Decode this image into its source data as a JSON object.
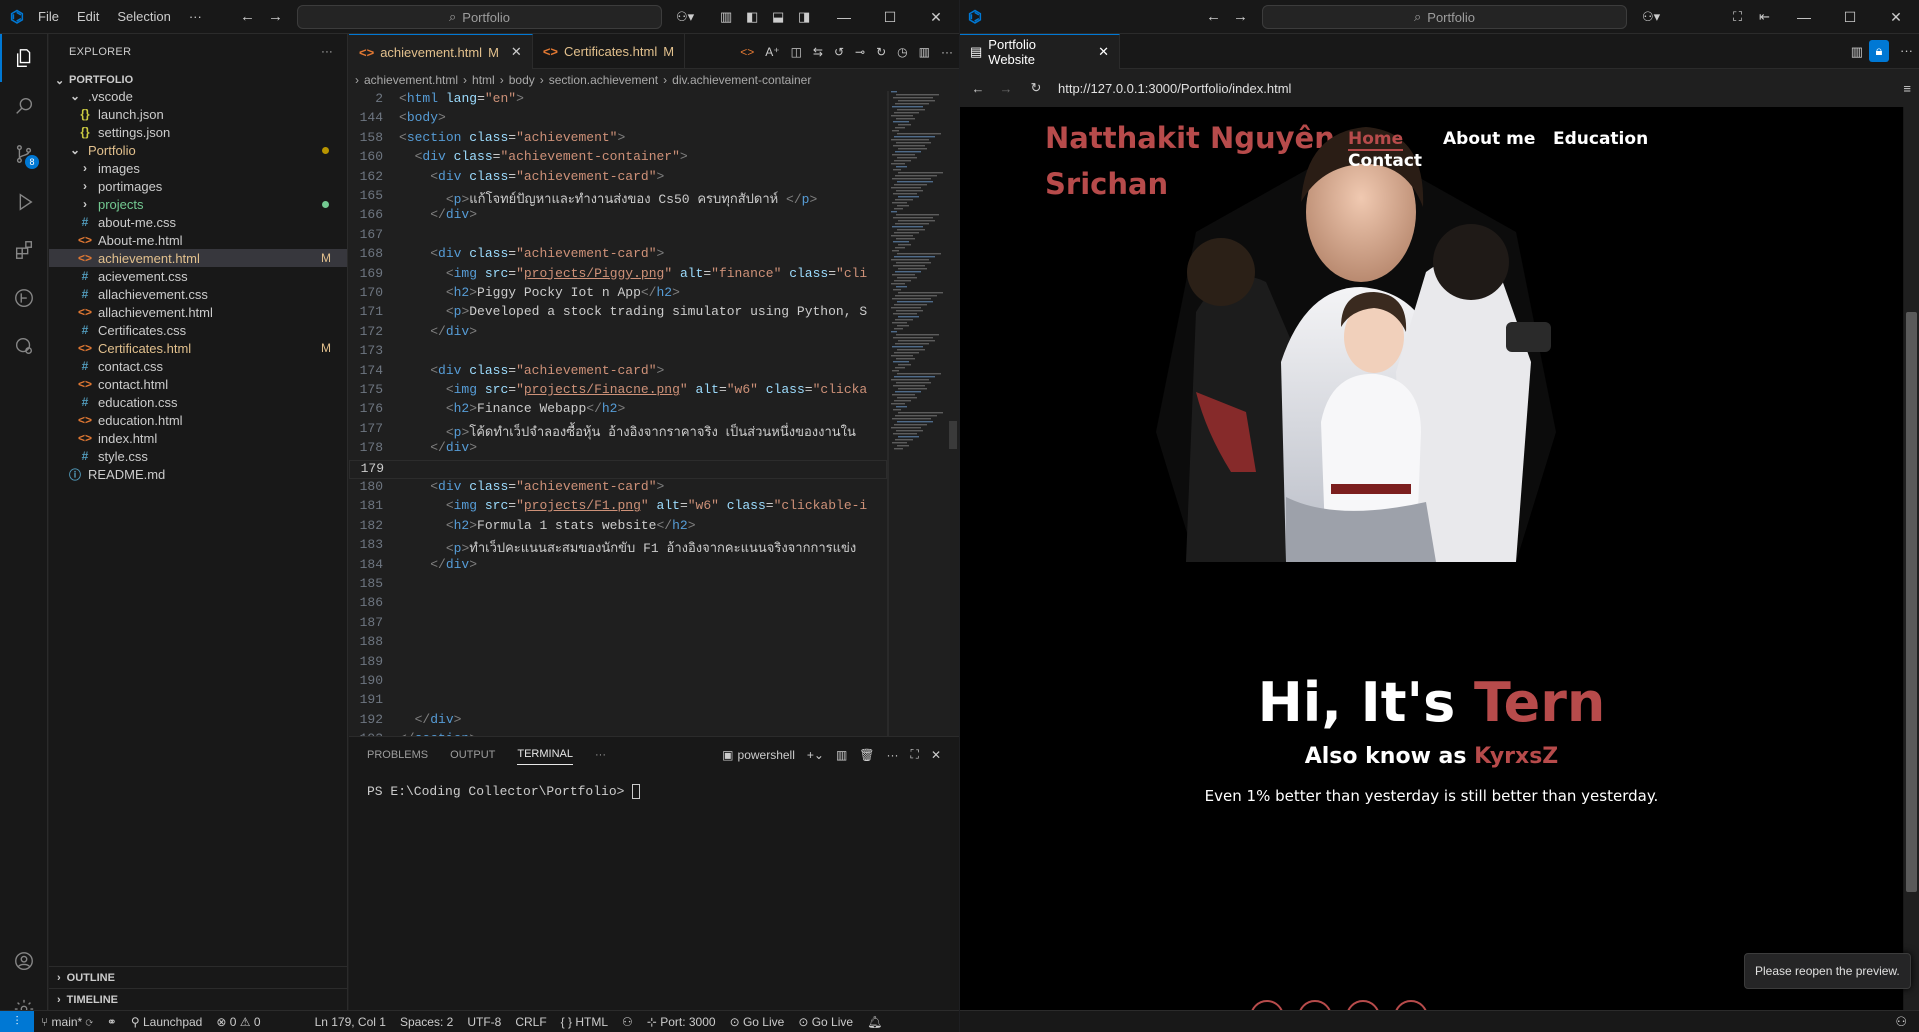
{
  "left": {
    "menu": [
      "File",
      "Edit",
      "Selection",
      "···"
    ],
    "command_center": "Portfolio",
    "explorer": {
      "title": "EXPLORER",
      "root": "PORTFOLIO",
      "items": [
        {
          "label": ".vscode",
          "type": "folder-open",
          "indent": 1
        },
        {
          "label": "launch.json",
          "type": "json",
          "indent": 2
        },
        {
          "label": "settings.json",
          "type": "json",
          "indent": 2
        },
        {
          "label": "Portfolio",
          "type": "folder-open",
          "indent": 1,
          "color": "#e2c08d",
          "dot": "#b89500"
        },
        {
          "label": "images",
          "type": "folder",
          "indent": 2
        },
        {
          "label": "portimages",
          "type": "folder",
          "indent": 2
        },
        {
          "label": "projects",
          "type": "folder",
          "indent": 2,
          "color": "#73c991",
          "dot": "#73c991"
        },
        {
          "label": "about-me.css",
          "type": "css",
          "indent": 2
        },
        {
          "label": "About-me.html",
          "type": "html",
          "indent": 2
        },
        {
          "label": "achievement.html",
          "type": "html",
          "indent": 2,
          "color": "#e2c08d",
          "mod": "M",
          "selected": true
        },
        {
          "label": "acievement.css",
          "type": "css",
          "indent": 2
        },
        {
          "label": "allachievement.css",
          "type": "css",
          "indent": 2
        },
        {
          "label": "allachievement.html",
          "type": "html",
          "indent": 2
        },
        {
          "label": "Certificates.css",
          "type": "css",
          "indent": 2
        },
        {
          "label": "Certificates.html",
          "type": "html",
          "indent": 2,
          "color": "#e2c08d",
          "mod": "M"
        },
        {
          "label": "contact.css",
          "type": "css",
          "indent": 2
        },
        {
          "label": "contact.html",
          "type": "html",
          "indent": 2
        },
        {
          "label": "education.css",
          "type": "css",
          "indent": 2
        },
        {
          "label": "education.html",
          "type": "html",
          "indent": 2
        },
        {
          "label": "index.html",
          "type": "html",
          "indent": 2
        },
        {
          "label": "style.css",
          "type": "css",
          "indent": 2
        },
        {
          "label": "README.md",
          "type": "info",
          "indent": 1
        }
      ],
      "outline": "OUTLINE",
      "timeline": "TIMELINE"
    },
    "tabs": [
      {
        "label": "achievement.html",
        "mod": "M",
        "active": true
      },
      {
        "label": "Certificates.html",
        "mod": "M",
        "active": false
      }
    ],
    "breadcrumb": [
      "achievement.html",
      "html",
      "body",
      "section.achievement",
      "div.achievement-container"
    ],
    "code_lines": [
      {
        "n": "2",
        "html": "<span class='p'>&lt;</span><span class='t'>html</span> <span class='a'>lang</span>=<span class='s'>\"en\"</span><span class='p'>&gt;</span>"
      },
      {
        "n": "144",
        "html": "<span class='p'>&lt;</span><span class='t'>body</span><span class='p'>&gt;</span>"
      },
      {
        "n": "158",
        "html": "<span class='p'>&lt;</span><span class='t'>section</span> <span class='a'>class</span>=<span class='s'>\"achievement\"</span><span class='p'>&gt;</span>"
      },
      {
        "n": "160",
        "html": "  <span class='p'>&lt;</span><span class='t'>div</span> <span class='a'>class</span>=<span class='s'>\"achievement-container\"</span><span class='p'>&gt;</span>"
      },
      {
        "n": "162",
        "html": "    <span class='p'>&lt;</span><span class='t'>div</span> <span class='a'>class</span>=<span class='s'>\"achievement-card\"</span><span class='p'>&gt;</span>"
      },
      {
        "n": "165",
        "html": "      <span class='p'>&lt;</span><span class='t'>p</span><span class='p'>&gt;</span>แก้โจทย์ปัญหาและทำงานส่งของ Cs50 ครบทุกสัปดาห์ <span class='p'>&lt;/</span><span class='t'>p</span><span class='p'>&gt;</span>"
      },
      {
        "n": "166",
        "html": "    <span class='p'>&lt;/</span><span class='t'>div</span><span class='p'>&gt;</span>"
      },
      {
        "n": "167",
        "html": ""
      },
      {
        "n": "168",
        "html": "    <span class='p'>&lt;</span><span class='t'>div</span> <span class='a'>class</span>=<span class='s'>\"achievement-card\"</span><span class='p'>&gt;</span>"
      },
      {
        "n": "169",
        "html": "      <span class='p'>&lt;</span><span class='t'>img</span> <span class='a'>src</span>=<span class='s'>\"</span><span class='u'>projects/Piggy.png</span><span class='s'>\"</span> <span class='a'>alt</span>=<span class='s'>\"finance\"</span> <span class='a'>class</span>=<span class='s'>\"cli</span>"
      },
      {
        "n": "170",
        "html": "      <span class='p'>&lt;</span><span class='t'>h2</span><span class='p'>&gt;</span>Piggy Pocky Iot n App<span class='p'>&lt;/</span><span class='t'>h2</span><span class='p'>&gt;</span>"
      },
      {
        "n": "171",
        "html": "      <span class='p'>&lt;</span><span class='t'>p</span><span class='p'>&gt;</span>Developed a stock trading simulator using Python, S"
      },
      {
        "n": "172",
        "html": "    <span class='p'>&lt;/</span><span class='t'>div</span><span class='p'>&gt;</span>"
      },
      {
        "n": "173",
        "html": ""
      },
      {
        "n": "174",
        "html": "    <span class='p'>&lt;</span><span class='t'>div</span> <span class='a'>class</span>=<span class='s'>\"achievement-card\"</span><span class='p'>&gt;</span>"
      },
      {
        "n": "175",
        "html": "      <span class='p'>&lt;</span><span class='t'>img</span> <span class='a'>src</span>=<span class='s'>\"</span><span class='u'>projects/Finacne.png</span><span class='s'>\"</span> <span class='a'>alt</span>=<span class='s'>\"w6\"</span> <span class='a'>class</span>=<span class='s'>\"clicka</span>"
      },
      {
        "n": "176",
        "html": "      <span class='p'>&lt;</span><span class='t'>h2</span><span class='p'>&gt;</span>Finance Webapp<span class='p'>&lt;/</span><span class='t'>h2</span><span class='p'>&gt;</span>"
      },
      {
        "n": "177",
        "html": "      <span class='p'>&lt;</span><span class='t'>p</span><span class='p'>&gt;</span>โค้ดทำเว็ปจำลองซื้อหุ้น อ้างอิงจากราคาจริง เป็นส่วนหนึ่งของงานใน"
      },
      {
        "n": "178",
        "html": "    <span class='p'>&lt;/</span><span class='t'>div</span><span class='p'>&gt;</span>"
      },
      {
        "n": "179",
        "html": "",
        "current": true
      },
      {
        "n": "180",
        "html": "    <span class='p'>&lt;</span><span class='t'>div</span> <span class='a'>class</span>=<span class='s'>\"achievement-card\"</span><span class='p'>&gt;</span>"
      },
      {
        "n": "181",
        "html": "      <span class='p'>&lt;</span><span class='t'>img</span> <span class='a'>src</span>=<span class='s'>\"</span><span class='u'>projects/F1.png</span><span class='s'>\"</span> <span class='a'>alt</span>=<span class='s'>\"w6\"</span> <span class='a'>class</span>=<span class='s'>\"clickable-i</span>"
      },
      {
        "n": "182",
        "html": "      <span class='p'>&lt;</span><span class='t'>h2</span><span class='p'>&gt;</span>Formula 1 stats website<span class='p'>&lt;/</span><span class='t'>h2</span><span class='p'>&gt;</span>"
      },
      {
        "n": "183",
        "html": "      <span class='p'>&lt;</span><span class='t'>p</span><span class='p'>&gt;</span>ทำเว็ปคะแนนสะสมของนักขับ F1 อ้างอิงจากคะแนนจริงจากการแข่ง"
      },
      {
        "n": "184",
        "html": "    <span class='p'>&lt;/</span><span class='t'>div</span><span class='p'>&gt;</span>"
      },
      {
        "n": "185",
        "html": ""
      },
      {
        "n": "186",
        "html": ""
      },
      {
        "n": "187",
        "html": ""
      },
      {
        "n": "188",
        "html": ""
      },
      {
        "n": "189",
        "html": ""
      },
      {
        "n": "190",
        "html": ""
      },
      {
        "n": "191",
        "html": ""
      },
      {
        "n": "192",
        "html": "  <span class='p'>&lt;/</span><span class='t'>div</span><span class='p'>&gt;</span>"
      },
      {
        "n": "193",
        "html": "<span class='p'>&lt;/</span><span class='t'>section</span><span class='p'>&gt;</span>"
      }
    ],
    "panel": {
      "tabs": [
        "PROBLEMS",
        "OUTPUT",
        "TERMINAL",
        "···"
      ],
      "active_tab": "TERMINAL",
      "shell": "powershell",
      "prompt": "PS E:\\Coding Collector\\Portfolio> "
    },
    "status": {
      "branch": "main*",
      "launchpad": "Launchpad",
      "errors": "0",
      "warnings": "0",
      "position": "Ln 179, Col 1",
      "spaces": "Spaces: 2",
      "encoding": "UTF-8",
      "eol": "CRLF",
      "language": "HTML",
      "port": "Port: 3000",
      "golive1": "Go Live",
      "golive2": "Go Live"
    },
    "source_control_badge": "8"
  },
  "right": {
    "command_center": "Portfolio",
    "tab": "Portfolio Website",
    "url": "http://127.0.0.1:3000/Portfolio/index.html",
    "site": {
      "name_line1": "Natthakit Nguyên",
      "name_line2": "Srichan",
      "nav": [
        "Home",
        "About me",
        "Education",
        "Contact"
      ],
      "hero_prefix": "Hi, It's ",
      "hero_name": "Tern",
      "aka_prefix": "Also know as ",
      "aka_name": "KyrxsZ",
      "tagline": "Even 1% better than yesterday is still better than yesterday."
    },
    "toast": "Please reopen the preview."
  },
  "colors": {
    "accent": "#0078d4",
    "brand_red": "#b74b4b",
    "modified": "#e2c08d",
    "untracked": "#73c991"
  }
}
